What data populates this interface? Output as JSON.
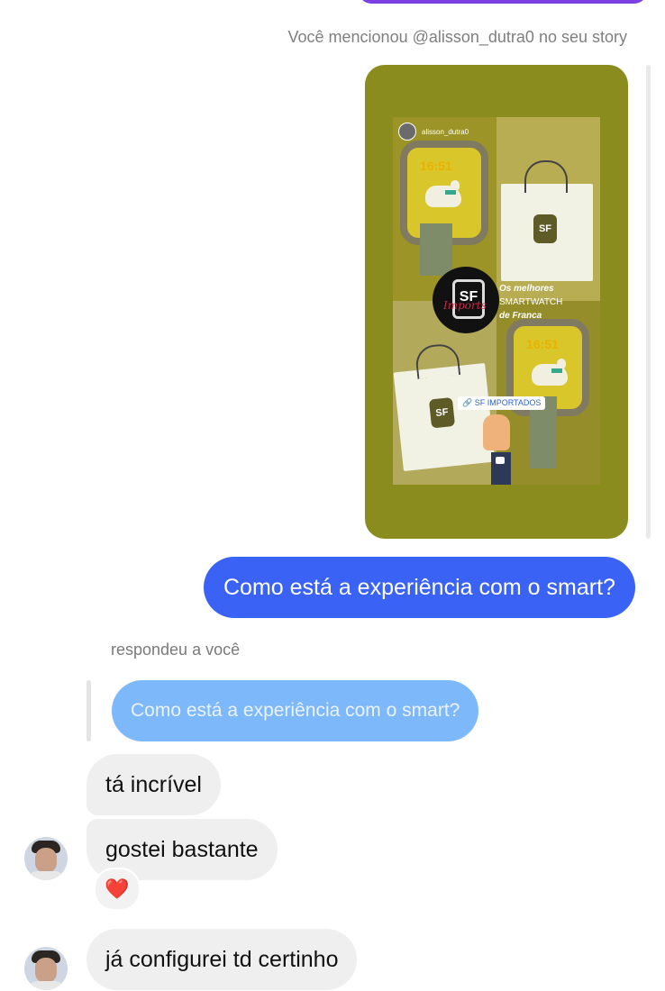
{
  "mention_note": "Você mencionou @alisson_dutra0 no seu story",
  "story": {
    "username": "alisson_dutra0",
    "watch_time_1": "16:51",
    "watch_time_2": "16:51",
    "logo_text": "SF",
    "logo_script": "Imports",
    "tagline_line1": "Os melhores",
    "tagline_line2": "SMARTWATCH",
    "tagline_line3": "de Franca",
    "link_sticker": "🔗 SF IMPORTADOS",
    "bag_logo": "SF"
  },
  "messages": {
    "sent": "Como está a experiência com o smart?",
    "reply_note": "respondeu a você",
    "quoted": "Como está a experiência com o smart?",
    "received": [
      "tá incrível",
      "gostei bastante",
      "já configurei td certinho"
    ],
    "reaction_icon": "heart-icon",
    "reaction": "❤️"
  },
  "colors": {
    "sent_bubble": "#3a63f6",
    "quoted_bubble": "#7db8fb",
    "received_bubble": "#efefef",
    "story_background": "#8a8d1d"
  }
}
